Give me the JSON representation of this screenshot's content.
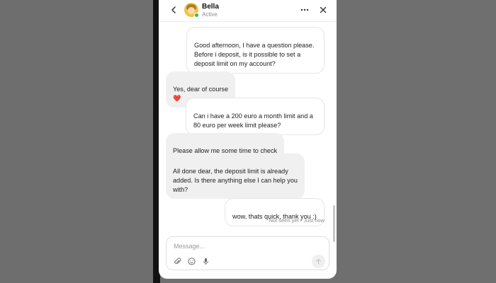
{
  "header": {
    "agent_name": "Bella",
    "agent_status": "Active"
  },
  "messages": [
    {
      "direction": "out",
      "text": "Good afternoon, I have a question please.\nBefore i deposit, is it possible to set a\ndeposit limit on my account?"
    },
    {
      "direction": "in",
      "text": "Yes, dear of course",
      "emoji": "❤️"
    },
    {
      "direction": "out",
      "text": "Can i have a 200 euro a month limit and a\n80 euro per week limit please?"
    },
    {
      "direction": "in",
      "text": "Please allow me some time to check",
      "emoji": "❤️"
    },
    {
      "direction": "in",
      "text": "All done dear, the deposit limit is already\nadded. Is there anything else I can help you\nwith?"
    },
    {
      "direction": "out",
      "text": "wow, thats quick, thank you :)"
    }
  ],
  "message_status": "Not seen yet • Just now",
  "composer": {
    "placeholder": "Message..."
  },
  "icons": {
    "back": "chevron-left-icon",
    "more": "more-horizontal-icon",
    "close": "close-icon",
    "attach": "paperclip-icon",
    "emoji": "smiley-icon",
    "mic": "microphone-icon",
    "send": "arrow-up-icon"
  },
  "colors": {
    "online": "#2ebd59",
    "heart": "#e0453a",
    "incoming_bubble": "#f0f0f0",
    "backdrop": "#6f6f6f"
  }
}
